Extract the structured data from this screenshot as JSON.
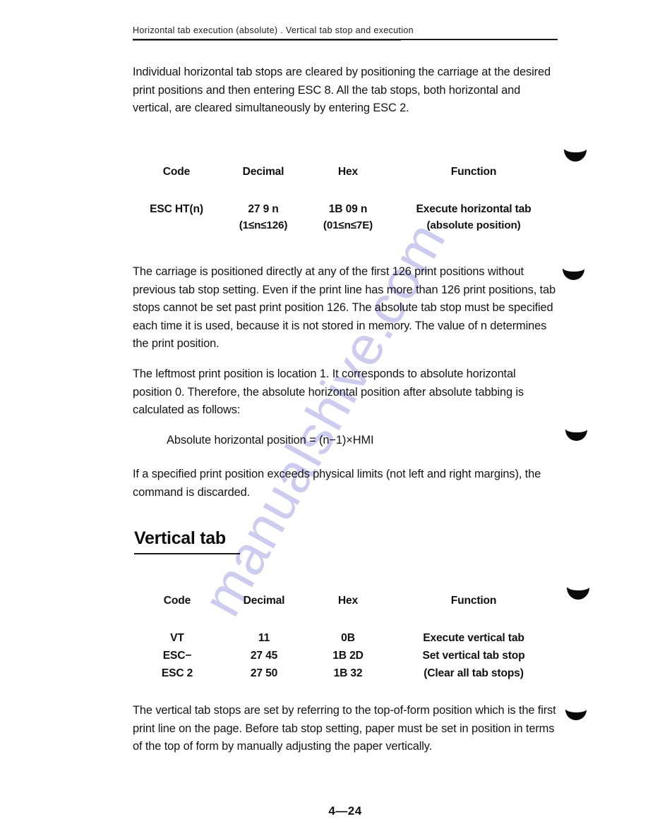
{
  "page": {
    "running_header": "Horizontal tab execution (absolute) . Vertical tab stop and execution",
    "page_number": "4—24",
    "watermark": "manualshive.com",
    "watermark_color": "#c9c8ef"
  },
  "body": {
    "paragraph_1": "Individual horizontal tab stops are cleared by positioning the carriage at the desired print positions and then entering ESC 8. All the tab stops, both horizontal and vertical, are cleared simultaneously by entering ESC 2.",
    "paragraph_2": "The carriage is positioned directly at any of the first 126 print positions without previous tab stop setting. Even if the print line has more than 126 print positions, tab stops cannot be set past print position 126. The absolute tab stop must be specified each time it is used, because it is not stored in memory. The value of n determines the print position.",
    "paragraph_3": "The leftmost print position is location 1. It corresponds to absolute horizontal position 0. Therefore, the absolute horizontal position after absolute tabbing is calculated as follows:",
    "formula": "Absolute horizontal position = (n−1)×HMI",
    "paragraph_4": "If a specified print position exceeds physical limits (not left and right margins), the command is discarded.",
    "paragraph_5": "The vertical tab stops are set by referring to the top-of-form position which is the first print line on the page. Before tab stop setting, paper must be set in position in terms of the top of form by manually adjusting the paper vertically."
  },
  "section_heading": "Vertical tab",
  "table_headers": {
    "code": "Code",
    "decimal": "Decimal",
    "hex": "Hex",
    "function": "Function"
  },
  "table_horizontal_tab": {
    "rows": [
      {
        "code": "ESC HT(n)",
        "decimal": "27 9 n",
        "decimal_sub": "(1≤n≤126)",
        "hex": "1B 09 n",
        "hex_sub": "(01≤n≤7E)",
        "function": "Execute horizontal tab",
        "function_sub": "(absolute position)"
      }
    ]
  },
  "table_vertical_tab": {
    "rows": [
      {
        "code": "VT",
        "decimal": "11",
        "hex": "0B",
        "function": "Execute vertical tab"
      },
      {
        "code": "ESC−",
        "decimal": "27 45",
        "hex": "1B 2D",
        "function": "Set vertical tab stop"
      },
      {
        "code": "ESC 2",
        "decimal": "27 50",
        "hex": "1B 32",
        "function": "(Clear all tab stops)"
      }
    ]
  }
}
